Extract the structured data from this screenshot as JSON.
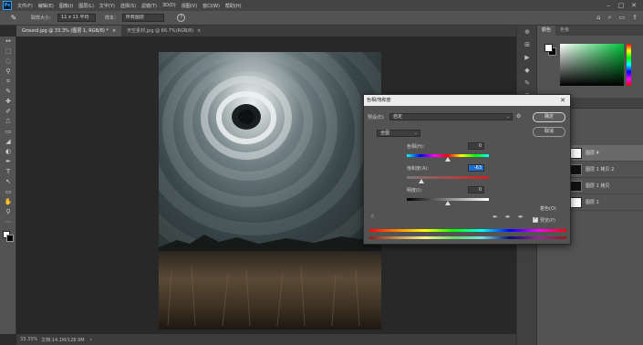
{
  "app": {
    "logo": "Ps",
    "menus": [
      "文件(F)",
      "编辑(E)",
      "图像(I)",
      "图层(L)",
      "文字(Y)",
      "选择(S)",
      "滤镜(T)",
      "3D(D)",
      "视图(V)",
      "窗口(W)",
      "帮助(H)"
    ],
    "window_controls": [
      "–",
      "□",
      "✕"
    ]
  },
  "options_bar": {
    "tool_icon": "eyedropper-icon",
    "sample_size_label": "取样大小：",
    "sample_size_value": "11 x 11 平均",
    "sample_label": "样本：",
    "sample_value": "所有图层",
    "help_glyph": "?",
    "right_icons": [
      "⌂",
      "⌕",
      "▭",
      "⇪"
    ]
  },
  "tabs": [
    {
      "label": "Ground.jpg @ 33.3% (图层 1, RGB/8) *",
      "close": "×",
      "active": true
    },
    {
      "label": "天空素材.jpg @ 66.7%(RGB/8)",
      "close": "×",
      "active": false
    }
  ],
  "status": {
    "zoom": "33.33%",
    "doc": "文档:14.1M/128.9M",
    "arrow": "›"
  },
  "toolbar": {
    "icons": [
      "↔",
      "⬚",
      "◌",
      "⚲",
      "⌗",
      "✎",
      "✚",
      "✐",
      "⎍",
      "▭",
      "◢",
      "◐",
      "✒",
      "T",
      "↖",
      "▭",
      "✋",
      "⚲",
      "⋯"
    ]
  },
  "right_strip_icons": [
    "⊕",
    "⊞",
    "▶",
    "◆",
    "✎",
    "⊟",
    "A",
    "¶"
  ],
  "color_panel": {
    "tabs": [
      "颜色",
      "色板"
    ],
    "fg": "#ffffff",
    "bg": "#000000",
    "field_hue": "#00c23a"
  },
  "layers_panel": {
    "tabs": [
      "图层",
      "通道"
    ],
    "layers": [
      {
        "name": "图层 4",
        "thumb": "white",
        "selected": true
      },
      {
        "name": "图层 1 拷贝 2",
        "thumb": "mask",
        "selected": false
      },
      {
        "name": "图层 1 拷贝",
        "thumb": "mask",
        "selected": false
      },
      {
        "name": "图层 1",
        "thumb": "white",
        "selected": false
      }
    ],
    "eye": "◉"
  },
  "dialog": {
    "title": "色相/饱和度",
    "close": "✕",
    "preset_label": "预设(E):",
    "preset_value": "自定",
    "gear": "⚙",
    "ok": "确定",
    "cancel": "取消",
    "channel_value": "全图",
    "hue_label": "色相(H):",
    "hue_value": "0",
    "sat_label": "饱和度(A):",
    "sat_value": "-63",
    "light_label": "明度(I):",
    "light_value": "0",
    "colorize_label": "着色(O)",
    "preview_label": "预览(P)",
    "hand_icon": "☝",
    "eyedroppers": [
      "✒",
      "✒",
      "✒"
    ],
    "chevron": "⌄"
  }
}
